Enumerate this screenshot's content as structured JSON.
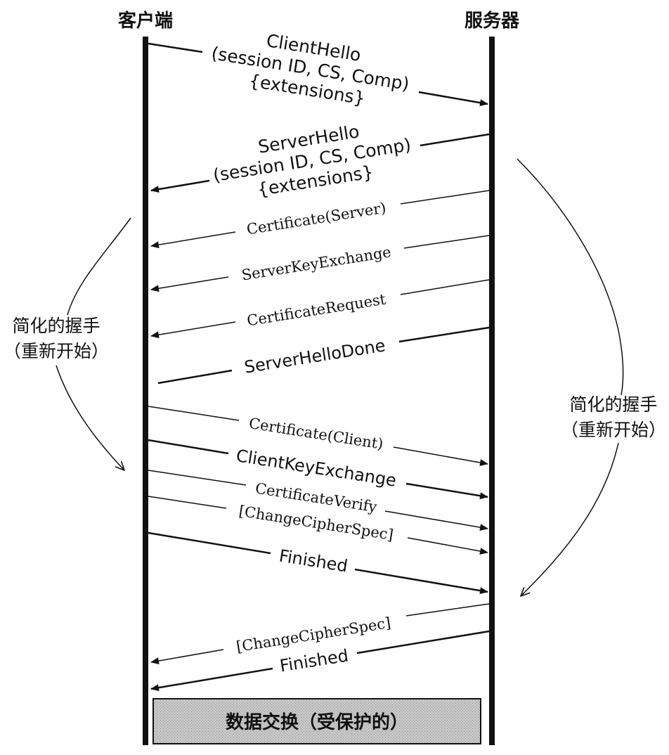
{
  "header": {
    "client": "客户端",
    "server": "服务器"
  },
  "messages": [
    {
      "id": "client-hello",
      "lines": [
        "ClientHello",
        "(session ID, CS, Comp)",
        "{extensions}"
      ],
      "direction": "client-to-server",
      "style": "bold"
    },
    {
      "id": "server-hello",
      "lines": [
        "ServerHello",
        "(session ID, CS, Comp)",
        "{extensions}"
      ],
      "direction": "server-to-client",
      "style": "bold"
    },
    {
      "id": "certificate-server",
      "lines": [
        "Certificate(Server)"
      ],
      "direction": "server-to-client",
      "style": "optional"
    },
    {
      "id": "server-key-exchange",
      "lines": [
        "ServerKeyExchange"
      ],
      "direction": "server-to-client",
      "style": "optional"
    },
    {
      "id": "certificate-request",
      "lines": [
        "CertificateRequest"
      ],
      "direction": "server-to-client",
      "style": "optional"
    },
    {
      "id": "server-hello-done",
      "lines": [
        "ServerHelloDone"
      ],
      "direction": "server-to-client",
      "style": "bold"
    },
    {
      "id": "certificate-client",
      "lines": [
        "Certificate(Client)"
      ],
      "direction": "client-to-server",
      "style": "optional"
    },
    {
      "id": "client-key-exchange",
      "lines": [
        "ClientKeyExchange"
      ],
      "direction": "client-to-server",
      "style": "bold"
    },
    {
      "id": "certificate-verify",
      "lines": [
        "CertificateVerify"
      ],
      "direction": "client-to-server",
      "style": "optional"
    },
    {
      "id": "change-cipher-spec-client",
      "lines": [
        "[ChangeCipherSpec]"
      ],
      "direction": "client-to-server",
      "style": "optional"
    },
    {
      "id": "finished-client",
      "lines": [
        "Finished"
      ],
      "direction": "client-to-server",
      "style": "bold"
    },
    {
      "id": "change-cipher-spec-server",
      "lines": [
        "[ChangeCipherSpec]"
      ],
      "direction": "server-to-client",
      "style": "optional"
    },
    {
      "id": "finished-server",
      "lines": [
        "Finished"
      ],
      "direction": "server-to-client",
      "style": "bold"
    }
  ],
  "annotations": {
    "left": [
      "简化的握手",
      "（重新开始）"
    ],
    "right": [
      "简化的握手",
      "（重新开始）"
    ]
  },
  "data_box": "数据交换（受保护的）",
  "colors": {
    "ink": "#111111",
    "box_fill": "#c8c8c8"
  }
}
